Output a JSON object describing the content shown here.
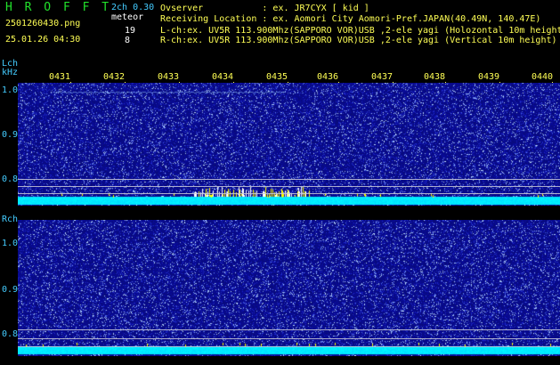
{
  "header": {
    "brand": "H R O F F T",
    "mode": "2ch 0.30",
    "meteor_label": "meteor",
    "filename": "2501260430.png",
    "datetime": "25.01.26 04:30",
    "count_l": "19",
    "count_r": "8",
    "observer": "Ovserver           : ex. JR7CYX [ kid ]",
    "location": "Receiving Location : ex. Aomori City Aomori-Pref.JAPAN(40.49N, 140.47E)",
    "lch_info": "L-ch:ex. UV5R 113.900Mhz(SAPPORO VOR)USB ,2-ele yagi (Holozontal 10m height)",
    "rch_info": "R-ch:ex. UV5R 113.900Mhz(SAPPORO VOR)USB ,2-ele yagi (Vertical 10m height)"
  },
  "panels": {
    "lch_label": "Lch",
    "khz_label": "kHz",
    "rch_label": "Rch",
    "time_ticks": [
      "0431",
      "0432",
      "0433",
      "0434",
      "0435",
      "0436",
      "0437",
      "0438",
      "0439",
      "0440"
    ],
    "freq_labels_top": [
      "1.0",
      "0.9",
      "0.8"
    ],
    "freq_labels_bottom": [
      "1.0",
      "0.9",
      "0.8"
    ]
  },
  "colors": {
    "background": "#000000",
    "noise_base": "#0b0d8c",
    "band": "#00e5ff",
    "label_cyan": "#44ccff",
    "label_yellow": "#ffff55",
    "brand_green": "#22e12b",
    "burst_yellow": "#ffff00"
  }
}
